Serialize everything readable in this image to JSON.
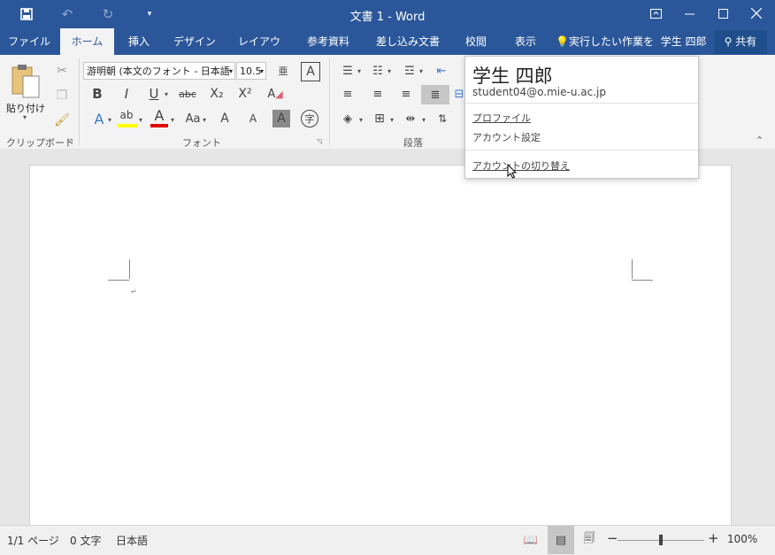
{
  "window": {
    "title": "文書 1 - Word",
    "quick_access": [
      "save-icon",
      "undo-icon",
      "redo-icon",
      "customize-qat-icon"
    ],
    "controls": [
      "ribbon-display-icon",
      "minimize-icon",
      "maximize-icon",
      "close-icon"
    ]
  },
  "tabs": [
    "ファイル",
    "ホーム",
    "挿入",
    "デザイン",
    "レイアウト",
    "参考資料",
    "差し込み文書",
    "校閲",
    "表示"
  ],
  "active_tab": "ホーム",
  "tell_me": "実行したい作業を",
  "user_name_tab": "学生 四郎",
  "share_label": "共有",
  "ribbon": {
    "clipboard": {
      "paste_label": "貼り付け",
      "group_label": "クリップボード"
    },
    "font": {
      "font_name": "游明朝 (本文のフォント - 日本語",
      "font_size": "10.5",
      "group_label": "フォント",
      "row2": [
        "B",
        "I",
        "U",
        "abc",
        "X₂",
        "X²"
      ],
      "row3": [
        "A",
        "ab",
        "A",
        "Aa",
        "A",
        "A",
        "A",
        "字"
      ]
    },
    "paragraph": {
      "group_label": "段落"
    }
  },
  "account_popup": {
    "name": "学生 四郎",
    "email": "student04@o.mie-u.ac.jp",
    "profile": "プロファイル",
    "settings": "アカウント設定",
    "switch": "アカウントの切り替え"
  },
  "status": {
    "page": "1/1 ページ",
    "words": "0 文字",
    "language": "日本語",
    "zoom": "100%",
    "zoom_level": 0.5
  },
  "colors": {
    "brand": "#2b579a",
    "highlight": "#ffff00",
    "font_color": "#e00000"
  }
}
